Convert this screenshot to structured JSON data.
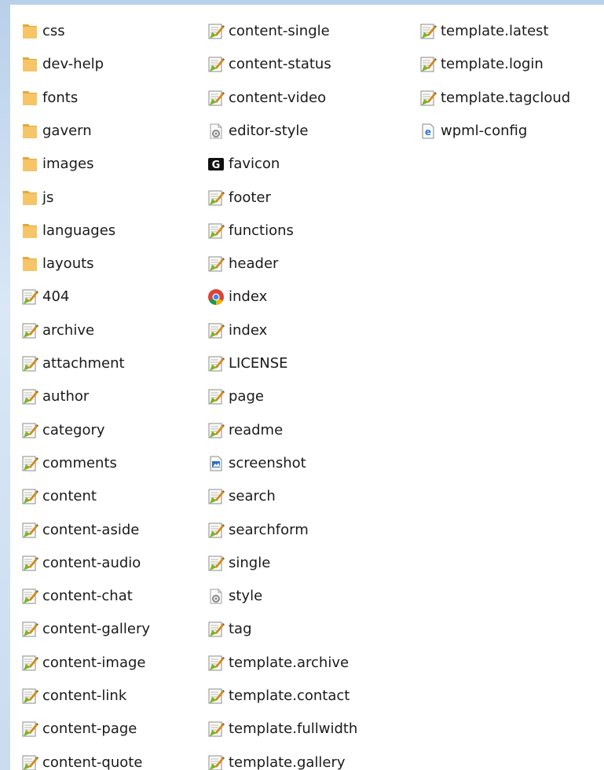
{
  "explorer": {
    "columns": [
      {
        "items": [
          {
            "name": "css",
            "icon": "folder-icon"
          },
          {
            "name": "dev-help",
            "icon": "folder-icon"
          },
          {
            "name": "fonts",
            "icon": "folder-icon"
          },
          {
            "name": "gavern",
            "icon": "folder-icon"
          },
          {
            "name": "images",
            "icon": "folder-icon"
          },
          {
            "name": "js",
            "icon": "folder-icon"
          },
          {
            "name": "languages",
            "icon": "folder-icon"
          },
          {
            "name": "layouts",
            "icon": "folder-icon"
          },
          {
            "name": "404",
            "icon": "script-file-icon"
          },
          {
            "name": "archive",
            "icon": "script-file-icon"
          },
          {
            "name": "attachment",
            "icon": "script-file-icon"
          },
          {
            "name": "author",
            "icon": "script-file-icon"
          },
          {
            "name": "category",
            "icon": "script-file-icon"
          },
          {
            "name": "comments",
            "icon": "script-file-icon"
          },
          {
            "name": "content",
            "icon": "script-file-icon"
          },
          {
            "name": "content-aside",
            "icon": "script-file-icon"
          },
          {
            "name": "content-audio",
            "icon": "script-file-icon"
          },
          {
            "name": "content-chat",
            "icon": "script-file-icon"
          },
          {
            "name": "content-gallery",
            "icon": "script-file-icon"
          },
          {
            "name": "content-image",
            "icon": "script-file-icon"
          },
          {
            "name": "content-link",
            "icon": "script-file-icon"
          },
          {
            "name": "content-page",
            "icon": "script-file-icon"
          },
          {
            "name": "content-quote",
            "icon": "script-file-icon"
          }
        ]
      },
      {
        "items": [
          {
            "name": "content-single",
            "icon": "script-file-icon"
          },
          {
            "name": "content-status",
            "icon": "script-file-icon"
          },
          {
            "name": "content-video",
            "icon": "script-file-icon"
          },
          {
            "name": "editor-style",
            "icon": "stylesheet-file-icon"
          },
          {
            "name": "favicon",
            "icon": "favicon-file-icon"
          },
          {
            "name": "footer",
            "icon": "script-file-icon"
          },
          {
            "name": "functions",
            "icon": "script-file-icon"
          },
          {
            "name": "header",
            "icon": "script-file-icon"
          },
          {
            "name": "index",
            "icon": "chrome-file-icon"
          },
          {
            "name": "index",
            "icon": "script-file-icon"
          },
          {
            "name": "LICENSE",
            "icon": "script-file-icon"
          },
          {
            "name": "page",
            "icon": "script-file-icon"
          },
          {
            "name": "readme",
            "icon": "script-file-icon"
          },
          {
            "name": "screenshot",
            "icon": "image-file-icon"
          },
          {
            "name": "search",
            "icon": "script-file-icon"
          },
          {
            "name": "searchform",
            "icon": "script-file-icon"
          },
          {
            "name": "single",
            "icon": "script-file-icon"
          },
          {
            "name": "style",
            "icon": "stylesheet-file-icon"
          },
          {
            "name": "tag",
            "icon": "script-file-icon"
          },
          {
            "name": "template.archive",
            "icon": "script-file-icon"
          },
          {
            "name": "template.contact",
            "icon": "script-file-icon"
          },
          {
            "name": "template.fullwidth",
            "icon": "script-file-icon"
          },
          {
            "name": "template.gallery",
            "icon": "script-file-icon"
          }
        ]
      },
      {
        "items": [
          {
            "name": "template.latest",
            "icon": "script-file-icon"
          },
          {
            "name": "template.login",
            "icon": "script-file-icon"
          },
          {
            "name": "template.tagcloud",
            "icon": "script-file-icon"
          },
          {
            "name": "wpml-config",
            "icon": "ie-xml-file-icon"
          }
        ]
      }
    ],
    "colors": {
      "folder": "#f5c567",
      "folder_dark": "#e2a93c",
      "script_green": "#7cb32b",
      "script_pen": "#d48a1c",
      "ie_blue": "#2a7bd0",
      "image_blue": "#2f6fbf"
    }
  }
}
